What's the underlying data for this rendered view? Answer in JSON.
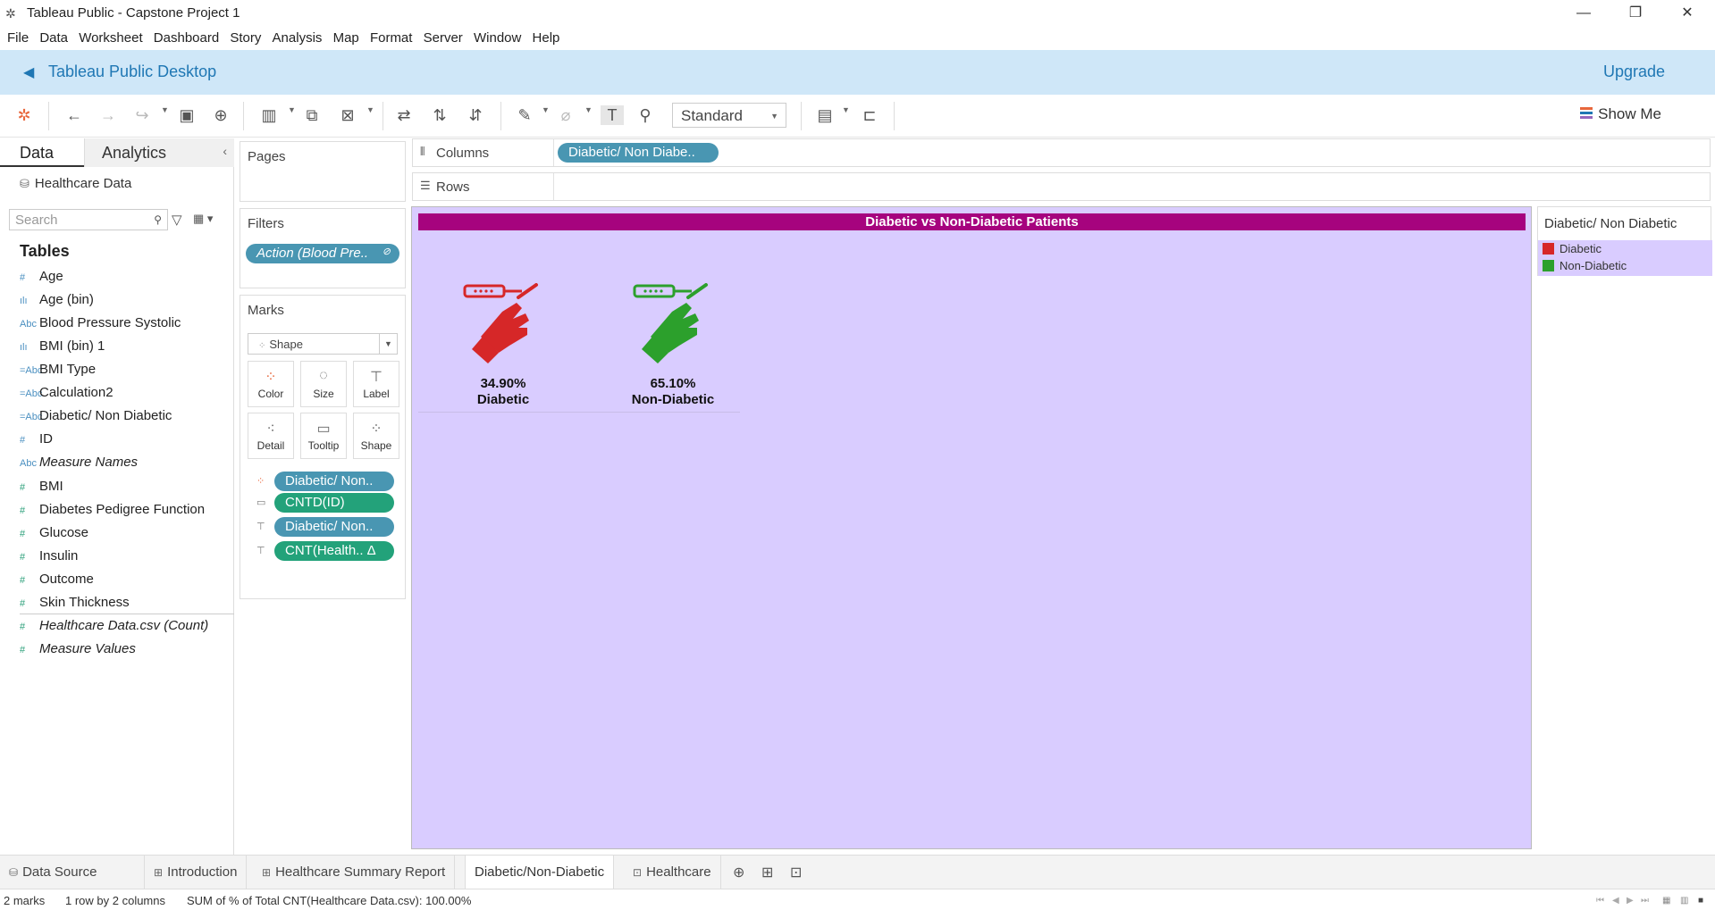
{
  "window": {
    "title": "Tableau Public - Capstone Project 1"
  },
  "menu": [
    "File",
    "Data",
    "Worksheet",
    "Dashboard",
    "Story",
    "Analysis",
    "Map",
    "Format",
    "Server",
    "Window",
    "Help"
  ],
  "banner": {
    "title": "Tableau Public Desktop",
    "upgrade": "Upgrade"
  },
  "toolbar": {
    "fit": "Standard",
    "show_me": "Show Me"
  },
  "data_pane": {
    "tab_data": "Data",
    "tab_analytics": "Analytics",
    "datasource": "Healthcare Data",
    "search_placeholder": "Search",
    "tables_heading": "Tables",
    "fields": [
      {
        "icon": "#",
        "name": "Age",
        "kind": "measure-blue"
      },
      {
        "icon": "ılı",
        "name": "Age (bin)",
        "kind": "bin"
      },
      {
        "icon": "Abc",
        "name": "Blood Pressure Systolic",
        "kind": "dim"
      },
      {
        "icon": "ılı",
        "name": "BMI (bin) 1",
        "kind": "bin"
      },
      {
        "icon": "=Abc",
        "name": "BMI Type",
        "kind": "dim"
      },
      {
        "icon": "=Abc",
        "name": "Calculation2",
        "kind": "dim"
      },
      {
        "icon": "=Abc",
        "name": "Diabetic/ Non Diabetic",
        "kind": "dim"
      },
      {
        "icon": "#",
        "name": "ID",
        "kind": "measure-blue"
      },
      {
        "icon": "Abc",
        "name": "Measure Names",
        "kind": "dim",
        "italic": true
      },
      {
        "icon": "#",
        "name": "BMI",
        "kind": "measure"
      },
      {
        "icon": "#",
        "name": "Diabetes Pedigree Function",
        "kind": "measure"
      },
      {
        "icon": "#",
        "name": "Glucose",
        "kind": "measure"
      },
      {
        "icon": "#",
        "name": "Insulin",
        "kind": "measure"
      },
      {
        "icon": "#",
        "name": "Outcome",
        "kind": "measure"
      },
      {
        "icon": "#",
        "name": "Skin Thickness",
        "kind": "measure"
      },
      {
        "icon": "#",
        "name": "Healthcare Data.csv (Count)",
        "kind": "measure",
        "italic": true
      },
      {
        "icon": "#",
        "name": "Measure Values",
        "kind": "measure",
        "italic": true
      }
    ]
  },
  "pages": {
    "label": "Pages"
  },
  "filters": {
    "label": "Filters",
    "pill": "Action (Blood Pre.."
  },
  "marks": {
    "label": "Marks",
    "type": "Shape",
    "buttons": [
      "Color",
      "Size",
      "Label",
      "Detail",
      "Tooltip",
      "Shape"
    ],
    "pills": [
      {
        "text": "Diabetic/ Non..",
        "color": "blue"
      },
      {
        "text": "CNTD(ID)",
        "color": "green"
      },
      {
        "text": "Diabetic/ Non..",
        "color": "blue"
      },
      {
        "text": "CNT(Health.. Δ",
        "color": "green"
      }
    ]
  },
  "shelves": {
    "columns_label": "Columns",
    "columns_pill": "Diabetic/ Non Diabe..",
    "rows_label": "Rows"
  },
  "chart_data": {
    "type": "shape",
    "title": "Diabetic vs Non-Diabetic Patients",
    "categories": [
      "Diabetic",
      "Non-Diabetic"
    ],
    "values": [
      34.9,
      65.1
    ],
    "value_labels": [
      "34.90%",
      "65.10%"
    ],
    "colors": [
      "#d62728",
      "#2ca02c"
    ],
    "background": "#d9ccff",
    "title_background": "#a6037e"
  },
  "legend": {
    "title": "Diabetic/ Non Diabetic",
    "items": [
      {
        "label": "Diabetic",
        "color": "#d62728"
      },
      {
        "label": "Non-Diabetic",
        "color": "#2ca02c"
      }
    ]
  },
  "sheet_tabs": [
    {
      "label": "Data Source",
      "icon": "⛁"
    },
    {
      "label": "Introduction",
      "icon": "⊞"
    },
    {
      "label": "Healthcare Summary Report",
      "icon": "⊞"
    },
    {
      "label": "Diabetic/Non-Diabetic",
      "icon": "",
      "active": true
    },
    {
      "label": "Healthcare",
      "icon": "⊡"
    }
  ],
  "status": {
    "marks": "2 marks",
    "rows_cols": "1 row by 2 columns",
    "sum": "SUM of % of Total CNT(Healthcare Data.csv): 100.00%"
  }
}
